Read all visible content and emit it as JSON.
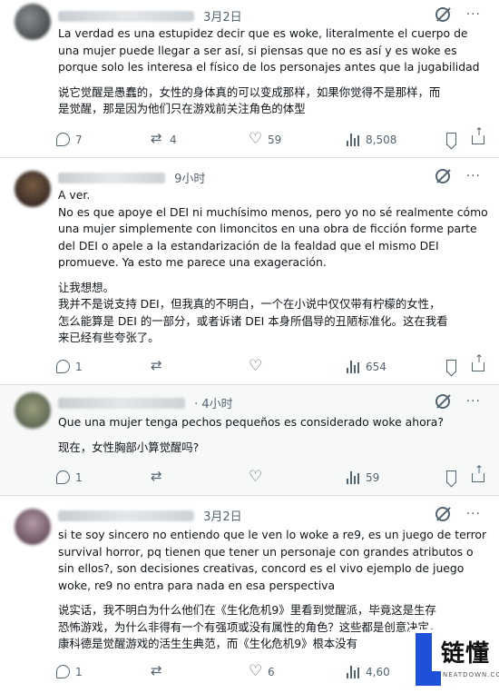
{
  "tweets": [
    {
      "time": "3月2日",
      "text_es": "La verdad es una estupidez decir que es woke, literalmente el cuerpo de\nuna mujer puede llegar a ser así, si piensas que no es así y es woke es\nporque solo les interesa el físico de los personajes antes que la jugabilidad",
      "text_zh": "说它觉醒是愚蠢的，女性的身体真的可以变成那样，如果你觉得不是那样，而\n是觉醒，那是因为他们只在游戏前关注角色的体型",
      "replies": "7",
      "retweets": "4",
      "likes": "59",
      "views": "8,508"
    },
    {
      "time": "9小时",
      "text_es": "A ver.\nNo es que apoye el DEI ni muchísimo menos, pero yo no sé realmente cómo\nuna mujer simplemente con limoncitos en una obra de ficción forme parte\ndel DEI o apele a la estandarización de la fealdad que el mismo DEI\npromueve. Ya esto me parece una exageración.",
      "text_zh": "让我想想。\n我并不是说支持 DEI，但我真的不明白，一个在小说中仅仅带有柠檬的女性，\n怎么能算是 DEI 的一部分，或者诉诸 DEI 本身所倡导的丑陋标准化。这在我看\n来已经有些夸张了。",
      "replies": "1",
      "retweets": "",
      "likes": "",
      "views": "654"
    },
    {
      "time": "· 4小时",
      "text_es": "Que una mujer tenga pechos pequeños es considerado woke ahora?",
      "text_zh": "现在，女性胸部小算觉醒吗?",
      "replies": "1",
      "retweets": "",
      "likes": "",
      "views": "59"
    },
    {
      "time": "3月2日",
      "text_es": "si te soy sincero no entiendo que le ven lo woke a re9, es un juego de terror\nsurvival horror, pq tienen que tener un personaje con grandes atributos o\nsin ellos?, son decisiones creativas, concord es el vivo ejemplo de juego\nwoke, re9 no entra para nada en esa perspectiva",
      "text_zh": "说实话，我不明白为什么他们在《生化危机9》里看到觉醒派，毕竟这是生存\n恐怖游戏，为什么非得有一个有强项或没有属性的角色？这些都是创意决定，\n康科德是觉醒游戏的活生生典范，而《生化危机9》根本没有",
      "replies": "1",
      "retweets": "",
      "likes": "6",
      "views": "4,60"
    }
  ],
  "watermark": {
    "title": "链懂",
    "subtitle": "NEATDOWN.COM"
  },
  "colors": {
    "text": "#0f1419",
    "secondary": "#536471",
    "divider": "#d9dee2",
    "highlight_bg": "#f7f9f9",
    "watermark_blue": "#1d4fd8"
  }
}
